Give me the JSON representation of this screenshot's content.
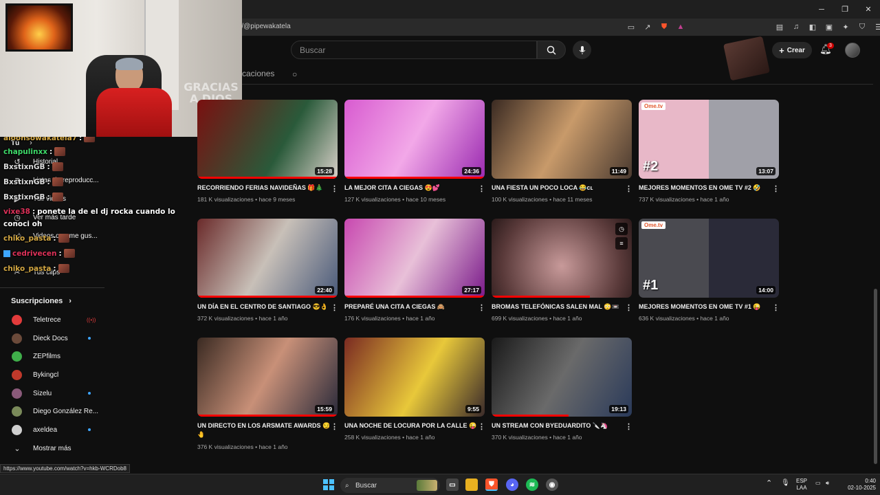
{
  "browser": {
    "url": "m/@pipewakatela",
    "window_controls": [
      "─",
      "❐",
      "✕"
    ]
  },
  "header": {
    "search_placeholder": "Buscar",
    "create_label": "Crear",
    "notif_count": "3"
  },
  "tabs": {
    "partial_label": "plicaciones"
  },
  "sidebar": {
    "items": [
      {
        "label": "Tú",
        "icon": "chevron-right-icon"
      },
      {
        "label": "Historial",
        "icon": "history-icon"
      },
      {
        "label": "Listas de reproducc...",
        "icon": "playlist-icon"
      },
      {
        "label": "Tus videos",
        "icon": "video-icon"
      },
      {
        "label": "Ver más tarde",
        "icon": "clock-icon"
      },
      {
        "label": "Videos que me gus...",
        "icon": "like-icon"
      },
      {
        "label": "Tus clips",
        "icon": "scissors-icon"
      }
    ],
    "subscriptions_title": "Suscripciones",
    "channels": [
      {
        "name": "Teletrece",
        "color": "#e23b3b",
        "live": true
      },
      {
        "name": "Dieck Docs",
        "color": "#6b4a3a",
        "new": true
      },
      {
        "name": "ZEPfilms",
        "color": "#3fae4a",
        "new": false
      },
      {
        "name": "Bykingcl",
        "color": "#c0392b",
        "new": false
      },
      {
        "name": "Sizelu",
        "color": "#8a5a7a",
        "new": true
      },
      {
        "name": "Diego González Re...",
        "color": "#7a8a5a",
        "new": false
      },
      {
        "name": "axeldea",
        "color": "#cfcfcf",
        "new": true
      }
    ],
    "show_more": "Mostrar más"
  },
  "chat": [
    {
      "user": "aloonsowakatela7",
      "user_color": "#d4a843",
      "msg": ""
    },
    {
      "user": "chapulinxx",
      "user_color": "#3fdc6a",
      "msg": ""
    },
    {
      "user": "BxstixnGB",
      "user_color": "#dddddd",
      "msg": ""
    },
    {
      "user": "BxstixnGB",
      "user_color": "#dddddd",
      "msg": ""
    },
    {
      "user": "BxstixnGB",
      "user_color": "#dddddd",
      "msg": ""
    },
    {
      "user": "vixe38",
      "user_color": "#e0325a",
      "msg": "ponete la de el dj rocka cuando lo"
    },
    {
      "user": "",
      "user_color": "#ffffff",
      "msg": "conoci oh"
    },
    {
      "user": "chiko_pasta",
      "user_color": "#d4a843",
      "msg": ""
    },
    {
      "user": "cedrivecen",
      "user_color": "#e0325a",
      "msg": ""
    },
    {
      "user": "chiko_pasta",
      "user_color": "#d4a843",
      "msg": ""
    }
  ],
  "videos": [
    {
      "title": "RECORRIENDO FERIAS NAVIDEÑAS 🎁🎄",
      "views": "181 K visualizaciones",
      "age": "hace 9 meses",
      "duration": "15:28",
      "progress": 1.0,
      "bg": "linear-gradient(120deg,#7a1010,#2a5a3a 60%,#d8d0c8)"
    },
    {
      "title": "LA MEJOR CITA A CIEGAS 😍💕",
      "views": "127 K visualizaciones",
      "age": "hace 10 meses",
      "duration": "24:36",
      "progress": 1.0,
      "bg": "linear-gradient(120deg,#d85bd0,#f2a8e8 50%,#9a2ab0)"
    },
    {
      "title": "UNA FIESTA UN POCO LOCA 😂cʟ",
      "views": "100 K visualizaciones",
      "age": "hace 11 meses",
      "duration": "11:49",
      "progress": 0,
      "bg": "linear-gradient(120deg,#3a2a22,#c89a6a 50%,#4a3a30)"
    },
    {
      "title": "MEJORES MOMENTOS EN OME TV #2 🤣",
      "views": "737 K visualizaciones",
      "age": "hace 1 año",
      "duration": "13:07",
      "progress": 0,
      "bg": "linear-gradient(90deg,#e8b8c8 50%,#a0a0a8 50%)",
      "ome": true,
      "rank": "#2"
    },
    {
      "title": "UN DÍA EN EL CENTRO DE SANTIAGO 😎👌",
      "views": "372 K visualizaciones",
      "age": "hace 1 año",
      "duration": "22:40",
      "progress": 1.0,
      "bg": "linear-gradient(120deg,#6a2a2a,#c8c0b8 50%,#4a5a7a)"
    },
    {
      "title": "PREPARÉ UNA CITA A CIEGAS 🙈",
      "views": "176 K visualizaciones",
      "age": "hace 1 año",
      "duration": "27:17",
      "progress": 1.0,
      "bg": "linear-gradient(120deg,#c848b0,#e8c0d8 50%,#7a1a8a)"
    },
    {
      "title": "BROMAS TELEFÓNICAS SALEN MAL 😳📼",
      "views": "699 K visualizaciones",
      "age": "hace 1 año",
      "duration": "",
      "progress": 0.7,
      "bg": "radial-gradient(circle at 50% 60%,#c89a9a,#5a3a3a 70%,#2a1a1a)",
      "hover": true
    },
    {
      "title": "MEJORES MOMENTOS EN OME TV #1 😜",
      "views": "636 K visualizaciones",
      "age": "hace 1 año",
      "duration": "14:00",
      "progress": 0,
      "bg": "linear-gradient(90deg,#4a4a50 50%,#2a2a38 50%)",
      "ome": true,
      "rank": "#1"
    },
    {
      "title": "UN DIRECTO EN LOS ARSMATE AWARDS 😏",
      "title2": "🤚",
      "views": "376 K visualizaciones",
      "age": "hace 1 año",
      "duration": "15:59",
      "progress": 1.0,
      "bg": "linear-gradient(120deg,#3a2a22,#c89078 50%,#2a2a3a)"
    },
    {
      "title": "UNA NOCHE DE LOCURA POR LA CALLE 😜",
      "views": "258 K visualizaciones",
      "age": "hace 1 año",
      "duration": "9:55",
      "progress": 0,
      "bg": "linear-gradient(120deg,#7a2a22,#e8c83a 55%,#3a2a2a)"
    },
    {
      "title": "UN STREAM CON BYEDUARDITO 🔪🦄",
      "views": "370 K visualizaciones",
      "age": "hace 1 año",
      "duration": "19:13",
      "progress": 0.55,
      "bg": "linear-gradient(120deg,#1a1a1a,#6a6a6a 50%,#2a3a5a)"
    }
  ],
  "status_url": "https://www.youtube.com/watch?v=hkb-WCRDob8",
  "taskbar": {
    "search_label": "Buscar",
    "lang": "ESP",
    "lang2": "LAA",
    "time": "0:40",
    "date": "02-10-2025"
  },
  "webcam": {
    "sign_text": "GRACIAS A DIOS"
  }
}
